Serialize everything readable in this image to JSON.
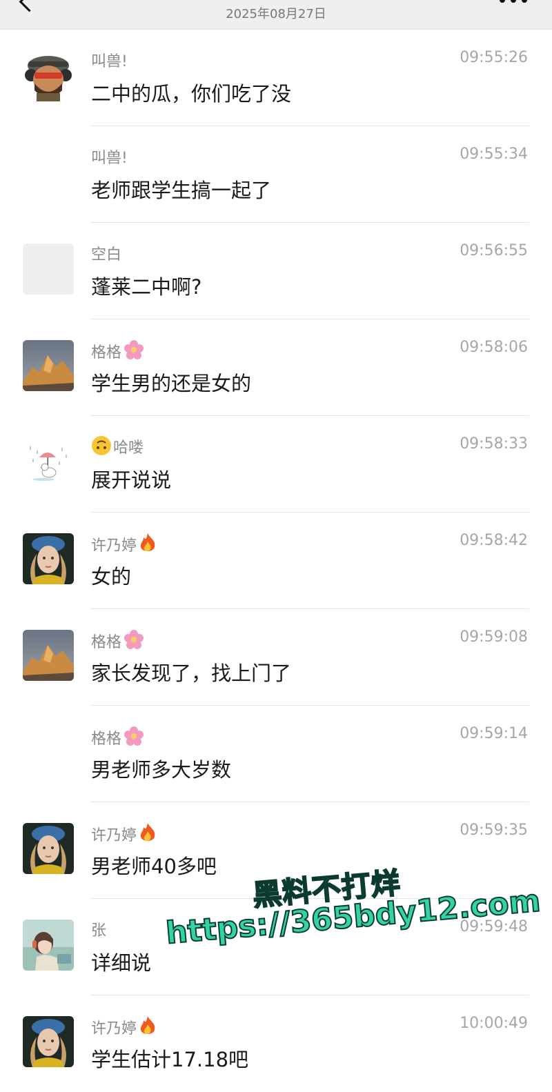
{
  "header": {
    "title": "",
    "date": "2025年08月27日"
  },
  "messages": [
    {
      "name": "叫兽!",
      "time": "09:55:26",
      "text": "二中的瓜，你们吃了没",
      "avatar": "soldier-avatar"
    },
    {
      "name": "叫兽!",
      "time": "09:55:34",
      "text": "老师跟学生搞一起了",
      "avatar": "none"
    },
    {
      "name": "空白",
      "time": "09:56:55",
      "text": "蓬莱二中啊?",
      "avatar": "blank-avatar"
    },
    {
      "name": "格格",
      "name_emoji": "cherry-blossom",
      "time": "09:58:06",
      "text": "学生男的还是女的",
      "avatar": "mountain-avatar"
    },
    {
      "name": "哈喽",
      "name_prefix_emoji": "upside-down-face",
      "time": "09:58:33",
      "text": "展开说说",
      "avatar": "duck-umbrella-avatar"
    },
    {
      "name": "许乃婷",
      "name_emoji": "fire",
      "time": "09:58:42",
      "text": "女的",
      "avatar": "portrait-avatar"
    },
    {
      "name": "格格",
      "name_emoji": "cherry-blossom",
      "time": "09:59:08",
      "text": "家长发现了，找上门了",
      "avatar": "mountain-avatar"
    },
    {
      "name": "格格",
      "name_emoji": "cherry-blossom",
      "time": "09:59:14",
      "text": "男老师多大岁数",
      "avatar": "none"
    },
    {
      "name": "许乃婷",
      "name_emoji": "fire",
      "time": "09:59:35",
      "text": "男老师40多吧",
      "avatar": "portrait-avatar"
    },
    {
      "name": "张",
      "time": "09:59:48",
      "text": "详细说",
      "avatar": "anime-avatar"
    },
    {
      "name": "许乃婷",
      "name_emoji": "fire",
      "time": "10:00:49",
      "text": "学生估计17.18吧",
      "avatar": "portrait-avatar"
    }
  ],
  "watermark": {
    "line1": "黑料不打烊",
    "line2": "https://365bdy12.com"
  },
  "colors": {
    "header_bg": "#efefef",
    "name": "#8a8a8a",
    "time": "#a6a6a6",
    "message": "#1a1a1a",
    "watermark": "#33d3a6"
  }
}
